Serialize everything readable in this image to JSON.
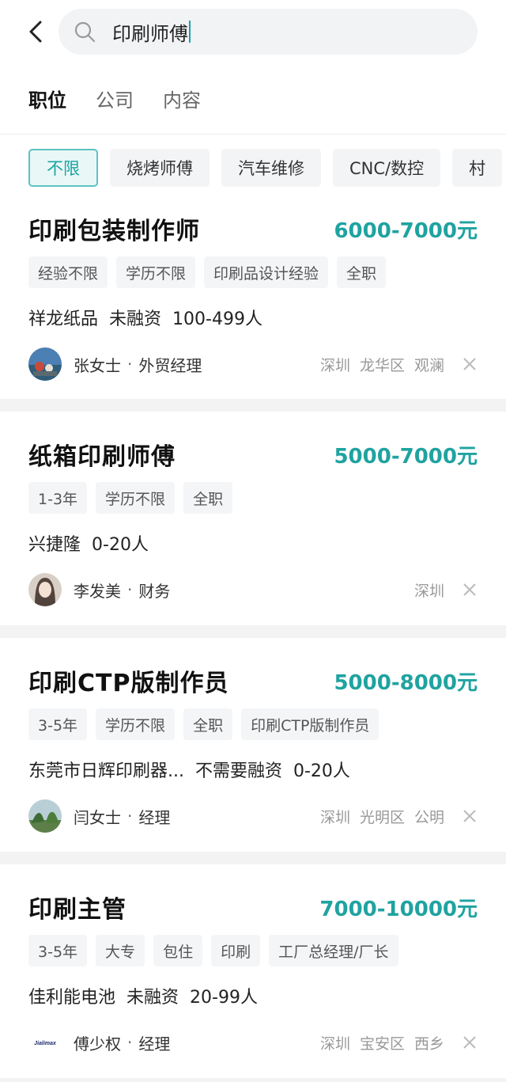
{
  "search": {
    "query": "印刷师傅"
  },
  "tabs": [
    {
      "label": "职位",
      "active": true
    },
    {
      "label": "公司",
      "active": false
    },
    {
      "label": "内容",
      "active": false
    }
  ],
  "filters": [
    "不限",
    "烧烤师傅",
    "汽车维修",
    "CNC/数控",
    "村"
  ],
  "accent_color": "#1fa3a0",
  "jobs": [
    {
      "title": "印刷包装制作师",
      "salary": "6000-7000元",
      "tags": [
        "经验不限",
        "学历不限",
        "印刷品设计经验",
        "全职"
      ],
      "company": [
        "祥龙纸品",
        "未融资",
        "100-499人"
      ],
      "recruiter": "张女士",
      "role": "外贸经理",
      "location": [
        "深圳",
        "龙华区",
        "观澜"
      ]
    },
    {
      "title": "纸箱印刷师傅",
      "salary": "5000-7000元",
      "tags": [
        "1-3年",
        "学历不限",
        "全职"
      ],
      "company": [
        "兴捷隆",
        "0-20人"
      ],
      "recruiter": "李发美",
      "role": "财务",
      "location": [
        "深圳"
      ]
    },
    {
      "title": "印刷CTP版制作员",
      "salary": "5000-8000元",
      "tags": [
        "3-5年",
        "学历不限",
        "全职",
        "印刷CTP版制作员"
      ],
      "company": [
        "东莞市日辉印刷器...",
        "不需要融资",
        "0-20人"
      ],
      "recruiter": "闫女士",
      "role": "经理",
      "location": [
        "深圳",
        "光明区",
        "公明"
      ]
    },
    {
      "title": "印刷主管",
      "salary": "7000-10000元",
      "tags": [
        "3-5年",
        "大专",
        "包住",
        "印刷",
        "工厂总经理/厂长"
      ],
      "company": [
        "佳利能电池",
        "未融资",
        "20-99人"
      ],
      "recruiter": "傅少权",
      "role": "经理",
      "location": [
        "深圳",
        "宝安区",
        "西乡"
      ],
      "logo_text": "Jialimax"
    }
  ]
}
